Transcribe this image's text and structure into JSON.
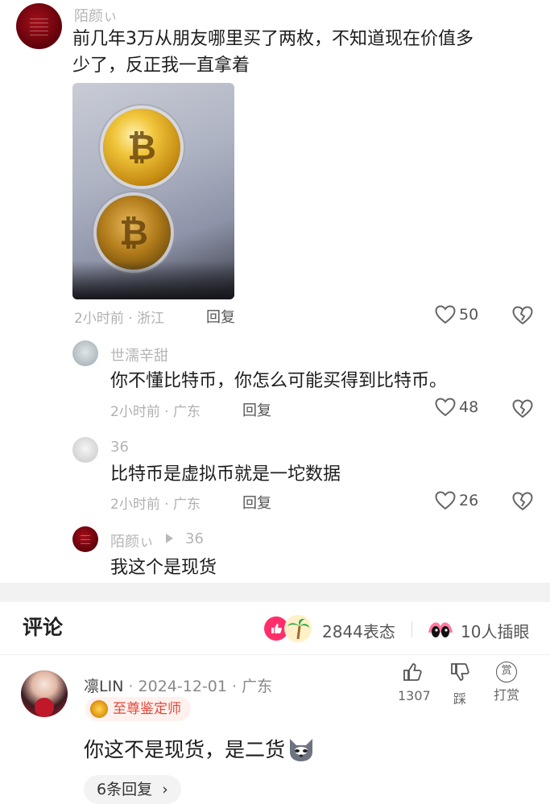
{
  "thread": {
    "root": {
      "username": "陌颜ぃ",
      "text_line1": "前几年3万从朋友哪里买了两枚，不知道现在价值多",
      "text_line2": "少了，反正我一直拿着",
      "meta": "2小时前 · 浙江",
      "reply_label": "回复",
      "likes": "50"
    },
    "replies": [
      {
        "username": "世濡辛甜",
        "text": "你不懂比特币，你怎么可能买得到比特币。",
        "meta": "2小时前 · 广东",
        "reply_label": "回复",
        "likes": "48"
      },
      {
        "username": "36",
        "text": "比特币是虚拟币就是一坨数据",
        "meta": "2小时前 · 广东",
        "reply_label": "回复",
        "likes": "26"
      },
      {
        "username": "陌颜ぃ",
        "reply_to": "36",
        "text": "我这个是现货"
      }
    ]
  },
  "comments_bar": {
    "title": "评论",
    "reactions_count": "2844表态",
    "spy_count": "10人插眼"
  },
  "top_comment": {
    "username": "凛LIN",
    "date": "2024-12-01",
    "location": "广东",
    "badge": "至尊鉴定师",
    "text": "你这不是现货，是二货",
    "replies_button": "6条回复",
    "like_count": "1307",
    "dislike_label": "踩",
    "tip_label": "打赏",
    "tip_icon_char": "赏"
  },
  "colors": {
    "accent_pink": "#ff2e6a",
    "badge_text": "#e0483a",
    "badge_bg": "#fff1ee"
  }
}
